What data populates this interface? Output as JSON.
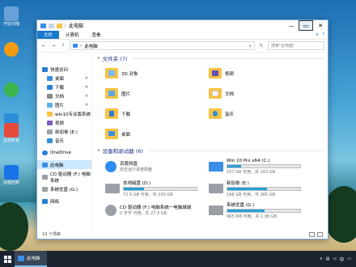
{
  "desktop": {
    "icons": [
      {
        "label": "开始扫描",
        "color": "#6aa0d8"
      },
      {
        "label": "",
        "color": "#f39c12"
      },
      {
        "label": "",
        "color": "#3ab54a"
      },
      {
        "label": "",
        "color": "#2a8fd8"
      },
      {
        "label": "迅雷影音",
        "color": "#e84b3c"
      },
      {
        "label": "远程控制",
        "color": "#1a73e8"
      }
    ]
  },
  "window": {
    "title": "此电脑",
    "controls": {
      "minimize": "—",
      "maximize": "▭",
      "close": "✕"
    },
    "ribbon_tabs": [
      "文件",
      "计算机",
      "查看"
    ],
    "help": "?",
    "nav_back": "←",
    "nav_forward": "→",
    "nav_up": "↑",
    "address": "此电脑",
    "address_sep": "›",
    "address_dropdown": "∨",
    "refresh": "↻",
    "search_placeholder": "搜索\"此电脑\""
  },
  "nav_pane": {
    "quick_access": "快速访问",
    "items": [
      {
        "label": "桌面",
        "pinned": true,
        "color": "#3a8ee6"
      },
      {
        "label": "下载",
        "pinned": true,
        "color": "#2a7fd4"
      },
      {
        "label": "文档",
        "pinned": true,
        "color": "#8a8a8a"
      },
      {
        "label": "图片",
        "pinned": true,
        "color": "#5ab0e8"
      },
      {
        "label": "win10专业版系统",
        "pinned": false,
        "color": "#f6c344"
      },
      {
        "label": "视频",
        "pinned": false,
        "color": "#7d5cbf"
      },
      {
        "label": "新加卷 (E:)",
        "pinned": false,
        "color": "#9aa0a6"
      },
      {
        "label": "音乐",
        "pinned": false,
        "color": "#2f8fdc"
      }
    ],
    "onedrive": "OneDrive",
    "this_pc": "此电脑",
    "cd_drive": "CD 驱动器 (F:) 电脑系统",
    "sys_drive": "系统优盘 (G:)",
    "network": "网络"
  },
  "folders": {
    "header": "文件夹 (7)",
    "items": [
      {
        "label": "3D 对象",
        "overlay": "#7ab8f5"
      },
      {
        "label": "视频",
        "overlay": "#6a4fb0"
      },
      {
        "label": "图片",
        "overlay": "#5aa9e6"
      },
      {
        "label": "文档",
        "overlay": "#ffffff"
      },
      {
        "label": "下载",
        "overlay": "#2a7fd4"
      },
      {
        "label": "音乐",
        "overlay": "#2f8fdc"
      },
      {
        "label": "桌面",
        "overlay": "#3a8ee6"
      }
    ]
  },
  "drives": {
    "header": "设备和驱动器 (6)",
    "items": [
      {
        "name": "百度网盘",
        "sub": "双击运行百度网盘",
        "free": "",
        "fill": null,
        "color": "#2c8df5"
      },
      {
        "name": "Win 10 Pro x64 (C:)",
        "sub": "",
        "free": "157 GB 可用，共 193 GB",
        "fill": 0.19,
        "color": "#3a8ee6"
      },
      {
        "name": "本地磁盘 (D:)",
        "sub": "",
        "free": "72.5 GB 可用，共 100 GB",
        "fill": 0.275,
        "color": "#9aa0a6"
      },
      {
        "name": "新加卷 (E:)",
        "sub": "",
        "free": "166 GB 可用，共 365 GB",
        "fill": 0.545,
        "color": "#9aa0a6"
      },
      {
        "name": "CD 驱动器 (F:) 电脑系统一电脑城城",
        "sub": "0 字节 可用，共 27.3 GB",
        "free": "",
        "fill": null,
        "color": "#9aa0a6"
      },
      {
        "name": "系统优盘 (G:)",
        "sub": "",
        "free": "965 MB 可用，共 1.98 GB",
        "fill": 0.51,
        "color": "#9aa0a6"
      }
    ]
  },
  "status": {
    "count": "13 个项目"
  },
  "taskbar": {
    "window_label": "此电脑",
    "time": "",
    "ime": "中"
  }
}
